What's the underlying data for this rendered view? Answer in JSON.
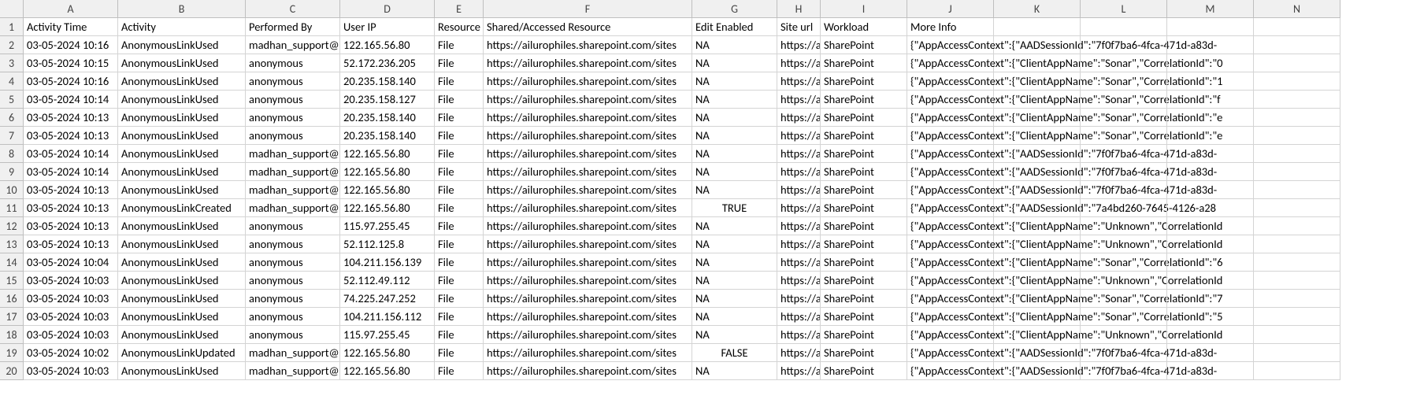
{
  "columns": [
    "A",
    "B",
    "C",
    "D",
    "E",
    "F",
    "G",
    "H",
    "I",
    "J",
    "K",
    "L",
    "M",
    "N"
  ],
  "headers": {
    "A": "Activity Time",
    "B": "Activity",
    "C": "Performed By",
    "D": "User IP",
    "E": "Resource",
    "F": "Shared/Accessed Resource",
    "G": "Edit Enabled",
    "H": "Site url",
    "I": "Workload",
    "J": "More Info",
    "K": "",
    "L": "",
    "M": "",
    "N": ""
  },
  "chart_data": {
    "type": "table",
    "columns": [
      "Activity Time",
      "Activity",
      "Performed By",
      "User IP",
      "Resource",
      "Shared/Accessed Resource",
      "Edit Enabled",
      "Site url",
      "Workload",
      "More Info"
    ],
    "rows": [
      [
        "03-05-2024 10:16",
        "AnonymousLinkUsed",
        "madhan_support@",
        "122.165.56.80",
        "File",
        "https://ailurophiles.sharepoint.com/sites",
        "NA",
        "https://ai",
        "SharePoint",
        "{\"AppAccessContext\":{\"AADSessionId\":\"7f0f7ba6-4fca-471d-a83d-"
      ],
      [
        "03-05-2024 10:15",
        "AnonymousLinkUsed",
        "anonymous",
        "52.172.236.205",
        "File",
        "https://ailurophiles.sharepoint.com/sites",
        "NA",
        "https://ai",
        "SharePoint",
        "{\"AppAccessContext\":{\"ClientAppName\":\"Sonar\",\"CorrelationId\":\"0"
      ],
      [
        "03-05-2024 10:16",
        "AnonymousLinkUsed",
        "anonymous",
        "20.235.158.140",
        "File",
        "https://ailurophiles.sharepoint.com/sites",
        "NA",
        "https://ai",
        "SharePoint",
        "{\"AppAccessContext\":{\"ClientAppName\":\"Sonar\",\"CorrelationId\":\"1"
      ],
      [
        "03-05-2024 10:14",
        "AnonymousLinkUsed",
        "anonymous",
        "20.235.158.127",
        "File",
        "https://ailurophiles.sharepoint.com/sites",
        "NA",
        "https://ai",
        "SharePoint",
        "{\"AppAccessContext\":{\"ClientAppName\":\"Sonar\",\"CorrelationId\":\"f"
      ],
      [
        "03-05-2024 10:13",
        "AnonymousLinkUsed",
        "anonymous",
        "20.235.158.140",
        "File",
        "https://ailurophiles.sharepoint.com/sites",
        "NA",
        "https://ai",
        "SharePoint",
        "{\"AppAccessContext\":{\"ClientAppName\":\"Sonar\",\"CorrelationId\":\"e"
      ],
      [
        "03-05-2024 10:13",
        "AnonymousLinkUsed",
        "anonymous",
        "20.235.158.140",
        "File",
        "https://ailurophiles.sharepoint.com/sites",
        "NA",
        "https://ai",
        "SharePoint",
        "{\"AppAccessContext\":{\"ClientAppName\":\"Sonar\",\"CorrelationId\":\"e"
      ],
      [
        "03-05-2024 10:14",
        "AnonymousLinkUsed",
        "madhan_support@",
        "122.165.56.80",
        "File",
        "https://ailurophiles.sharepoint.com/sites",
        "NA",
        "https://ai",
        "SharePoint",
        "{\"AppAccessContext\":{\"AADSessionId\":\"7f0f7ba6-4fca-471d-a83d-"
      ],
      [
        "03-05-2024 10:14",
        "AnonymousLinkUsed",
        "madhan_support@",
        "122.165.56.80",
        "File",
        "https://ailurophiles.sharepoint.com/sites",
        "NA",
        "https://ai",
        "SharePoint",
        "{\"AppAccessContext\":{\"AADSessionId\":\"7f0f7ba6-4fca-471d-a83d-"
      ],
      [
        "03-05-2024 10:13",
        "AnonymousLinkUsed",
        "madhan_support@",
        "122.165.56.80",
        "File",
        "https://ailurophiles.sharepoint.com/sites",
        "NA",
        "https://ai",
        "SharePoint",
        "{\"AppAccessContext\":{\"AADSessionId\":\"7f0f7ba6-4fca-471d-a83d-"
      ],
      [
        "03-05-2024 10:13",
        "AnonymousLinkCreated",
        "madhan_support@",
        "122.165.56.80",
        "File",
        "https://ailurophiles.sharepoint.com/sites",
        "TRUE",
        "https://ai",
        "SharePoint",
        "{\"AppAccessContext\":{\"AADSessionId\":\"7a4bd260-7645-4126-a28"
      ],
      [
        "03-05-2024 10:13",
        "AnonymousLinkUsed",
        "anonymous",
        "115.97.255.45",
        "File",
        "https://ailurophiles.sharepoint.com/sites",
        "NA",
        "https://ai",
        "SharePoint",
        "{\"AppAccessContext\":{\"ClientAppName\":\"Unknown\",\"CorrelationId"
      ],
      [
        "03-05-2024 10:13",
        "AnonymousLinkUsed",
        "anonymous",
        "52.112.125.8",
        "File",
        "https://ailurophiles.sharepoint.com/sites",
        "NA",
        "https://ai",
        "SharePoint",
        "{\"AppAccessContext\":{\"ClientAppName\":\"Unknown\",\"CorrelationId"
      ],
      [
        "03-05-2024 10:04",
        "AnonymousLinkUsed",
        "anonymous",
        "104.211.156.139",
        "File",
        "https://ailurophiles.sharepoint.com/sites",
        "NA",
        "https://ai",
        "SharePoint",
        "{\"AppAccessContext\":{\"ClientAppName\":\"Sonar\",\"CorrelationId\":\"6"
      ],
      [
        "03-05-2024 10:03",
        "AnonymousLinkUsed",
        "anonymous",
        "52.112.49.112",
        "File",
        "https://ailurophiles.sharepoint.com/sites",
        "NA",
        "https://ai",
        "SharePoint",
        "{\"AppAccessContext\":{\"ClientAppName\":\"Unknown\",\"CorrelationId"
      ],
      [
        "03-05-2024 10:03",
        "AnonymousLinkUsed",
        "anonymous",
        "74.225.247.252",
        "File",
        "https://ailurophiles.sharepoint.com/sites",
        "NA",
        "https://ai",
        "SharePoint",
        "{\"AppAccessContext\":{\"ClientAppName\":\"Sonar\",\"CorrelationId\":\"7"
      ],
      [
        "03-05-2024 10:03",
        "AnonymousLinkUsed",
        "anonymous",
        "104.211.156.112",
        "File",
        "https://ailurophiles.sharepoint.com/sites",
        "NA",
        "https://ai",
        "SharePoint",
        "{\"AppAccessContext\":{\"ClientAppName\":\"Sonar\",\"CorrelationId\":\"5"
      ],
      [
        "03-05-2024 10:03",
        "AnonymousLinkUsed",
        "anonymous",
        "115.97.255.45",
        "File",
        "https://ailurophiles.sharepoint.com/sites",
        "NA",
        "https://ai",
        "SharePoint",
        "{\"AppAccessContext\":{\"ClientAppName\":\"Unknown\",\"CorrelationId"
      ],
      [
        "03-05-2024 10:02",
        "AnonymousLinkUpdated",
        "madhan_support@",
        "122.165.56.80",
        "File",
        "https://ailurophiles.sharepoint.com/sites",
        "FALSE",
        "https://ai",
        "SharePoint",
        "{\"AppAccessContext\":{\"AADSessionId\":\"7f0f7ba6-4fca-471d-a83d-"
      ],
      [
        "03-05-2024 10:03",
        "AnonymousLinkUsed",
        "madhan_support@",
        "122.165.56.80",
        "File",
        "https://ailurophiles.sharepoint.com/sites",
        "NA",
        "https://ai",
        "SharePoint",
        "{\"AppAccessContext\":{\"AADSessionId\":\"7f0f7ba6-4fca-471d-a83d-"
      ]
    ]
  }
}
